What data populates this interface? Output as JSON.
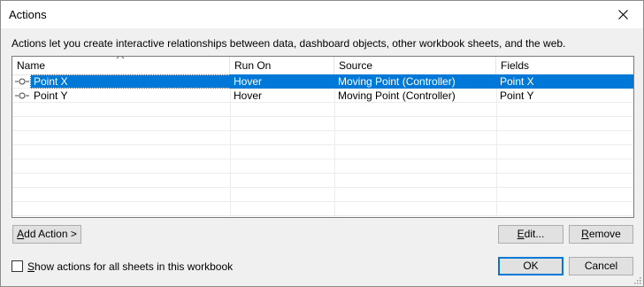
{
  "window": {
    "title": "Actions"
  },
  "description": "Actions let you create interactive relationships between data, dashboard objects, other workbook sheets, and the web.",
  "table": {
    "columns": [
      "Name",
      "Run On",
      "Source",
      "Fields"
    ],
    "rows": [
      {
        "name": "Point X",
        "run_on": "Hover",
        "source": "Moving Point (Controller)",
        "fields": "Point X",
        "selected": true
      },
      {
        "name": "Point Y",
        "run_on": "Hover",
        "source": "Moving Point (Controller)",
        "fields": "Point Y",
        "selected": false
      }
    ],
    "empty_row_count": 8
  },
  "buttons": {
    "add_action": {
      "mnemonic": "A",
      "rest": "dd Action >"
    },
    "edit": {
      "mnemonic": "E",
      "rest": "dit..."
    },
    "remove": {
      "mnemonic": "R",
      "rest": "emove"
    },
    "ok": "OK",
    "cancel": "Cancel"
  },
  "checkbox": {
    "mnemonic": "S",
    "rest": "how actions for all sheets in this workbook",
    "checked": false
  },
  "colors": {
    "selection": "#0078d7",
    "dialog_bg": "#f0f0f0"
  },
  "icons": {
    "close": "close-icon",
    "sort": "sort-ascending-icon",
    "action": "hover-action-icon"
  }
}
